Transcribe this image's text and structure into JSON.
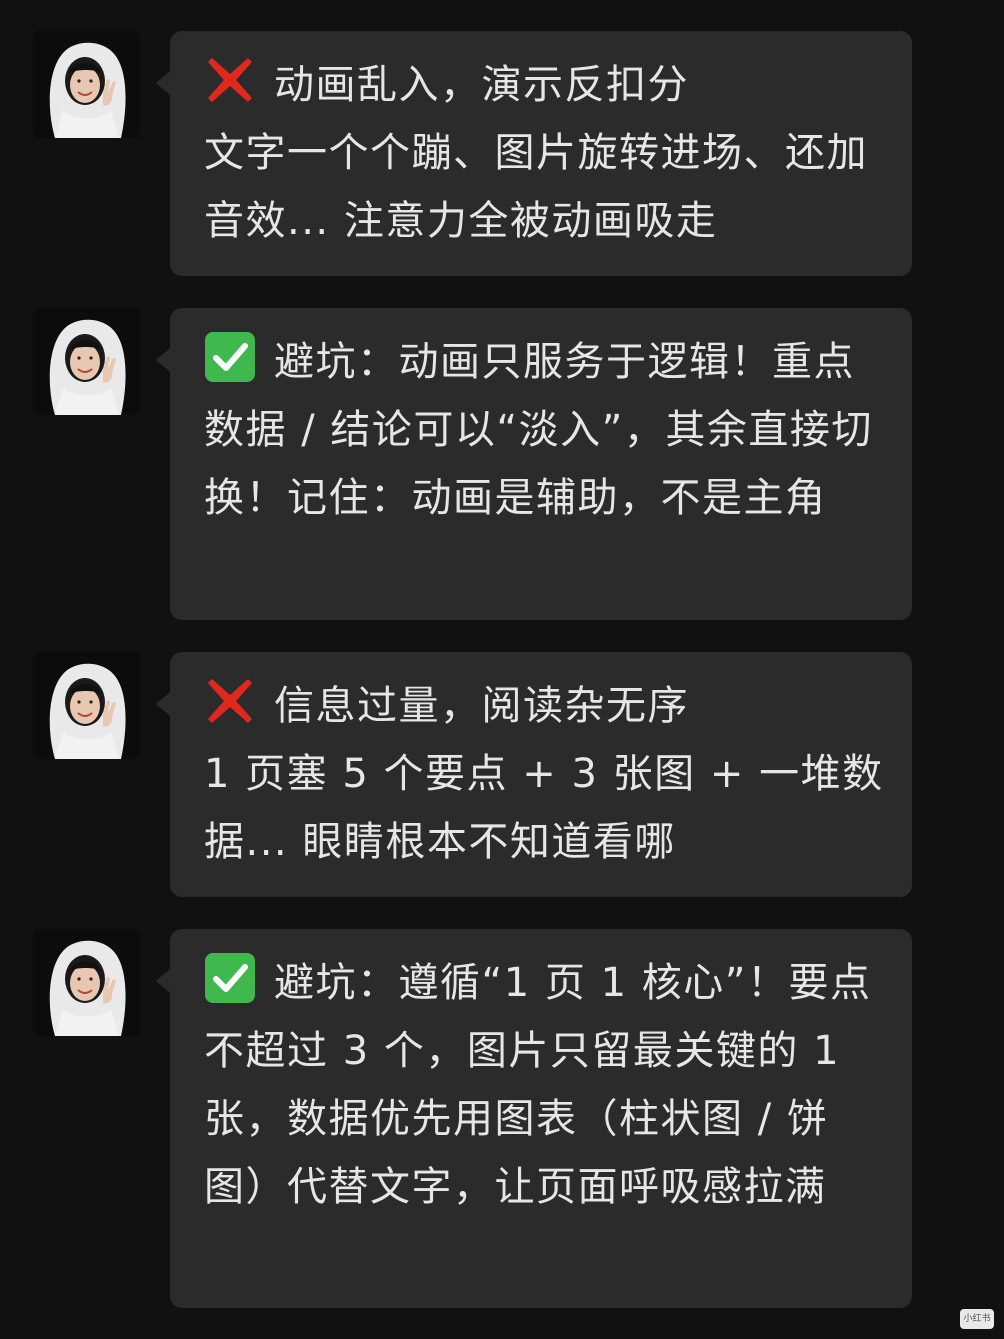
{
  "colors": {
    "background": "#111111",
    "bubble": "#2b2b2b",
    "text": "#e6e6e6",
    "cross": "#e0281e",
    "check": "#3fb94e"
  },
  "messages": [
    {
      "icon": "cross-mark-icon",
      "heading": "动画乱入，演示反扣分",
      "body": "文字一个个蹦、图片旋转进场、还加音效... 注意力全被动画吸走"
    },
    {
      "icon": "check-mark-icon",
      "heading": "避坑：动画只服务于逻辑！重点数据 / 结论可以“淡入”，其余直接切换！记住：动画是辅助，不是主角",
      "body": ""
    },
    {
      "icon": "cross-mark-icon",
      "heading": "信息过量，阅读杂无序",
      "body": "1 页塞 5 个要点 + 3 张图 + 一堆数据... 眼睛根本不知道看哪"
    },
    {
      "icon": "check-mark-icon",
      "heading": "避坑：遵循“1 页 1 核心”！要点不超过 3 个，图片只留最关键的 1 张，数据优先用图表（柱状图 / 饼图）代替文字，让页面呼吸感拉满",
      "body": ""
    }
  ],
  "watermark": "小红书"
}
